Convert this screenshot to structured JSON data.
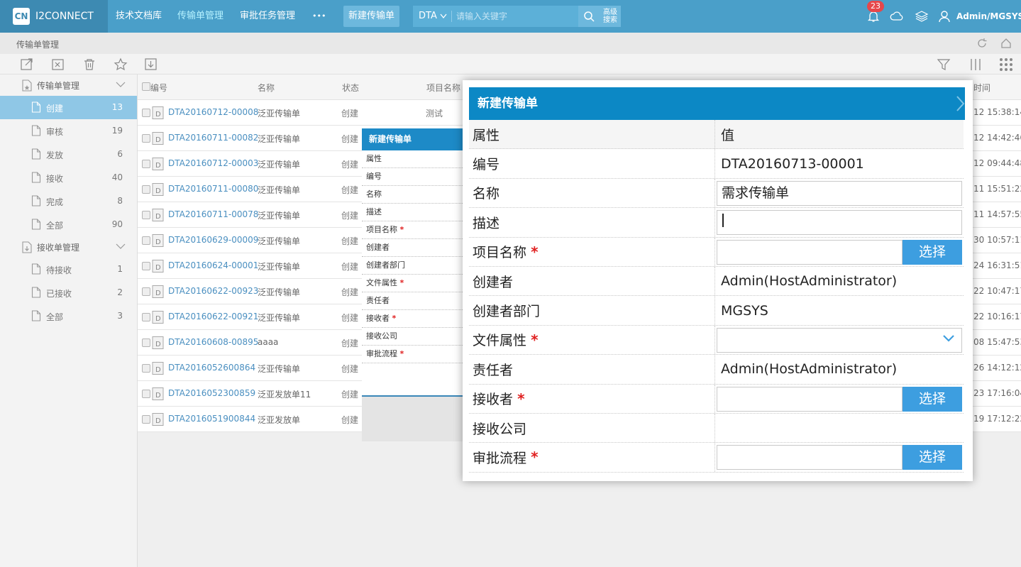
{
  "topbar": {
    "brand": "I2CONNECT",
    "brand_logo": "CN",
    "nav": [
      "技术文档库",
      "传输单管理",
      "审批任务管理"
    ],
    "more": "•••",
    "new_button": "新建传输单",
    "search_scope": "DTA",
    "search_placeholder": "请输入关键字",
    "advanced": [
      "高级",
      "搜索"
    ],
    "notification_count": "23",
    "user": "Admin/MGSYS",
    "colors": {
      "bar": "#4a9fc9",
      "brand_bg": "#3d8ab2",
      "badge": "#e6474b"
    }
  },
  "breadcrumb": "传输单管理",
  "sidebar": {
    "groups": [
      {
        "label": "传输单管理",
        "items": [
          {
            "label": "创建",
            "count": "13"
          },
          {
            "label": "审核",
            "count": "19"
          },
          {
            "label": "发放",
            "count": "6"
          },
          {
            "label": "接收",
            "count": "40"
          },
          {
            "label": "完成",
            "count": "8"
          },
          {
            "label": "全部",
            "count": "90"
          }
        ]
      },
      {
        "label": "接收单管理",
        "items": [
          {
            "label": "待接收",
            "count": "1"
          },
          {
            "label": "已接收",
            "count": "2"
          },
          {
            "label": "全部",
            "count": "3"
          }
        ]
      }
    ]
  },
  "table": {
    "headers": {
      "code": "编号",
      "name": "名称",
      "status": "状态",
      "project": "项目名称",
      "time": "时间"
    },
    "rows": [
      {
        "code": "DTA20160712-00008",
        "name": "泛亚传输单",
        "status": "创建",
        "project": "测试",
        "time": "12 15:38:14"
      },
      {
        "code": "DTA20160711-00082",
        "name": "泛亚传输单",
        "status": "创建",
        "project": "",
        "time": "12 14:42:46"
      },
      {
        "code": "DTA20160712-00003",
        "name": "泛亚传输单",
        "status": "创建",
        "project": "",
        "time": "12 09:44:48"
      },
      {
        "code": "DTA20160711-00080",
        "name": "泛亚传输单",
        "status": "创建",
        "project": "",
        "time": "11 15:51:22"
      },
      {
        "code": "DTA20160711-00078",
        "name": "泛亚传输单",
        "status": "创建",
        "project": "",
        "time": "11 14:57:55"
      },
      {
        "code": "DTA20160629-00009",
        "name": "泛亚传输单",
        "status": "创建",
        "project": "",
        "time": "30 10:57:11"
      },
      {
        "code": "DTA20160624-00001",
        "name": "泛亚传输单",
        "status": "创建",
        "project": "",
        "time": "24 16:31:51"
      },
      {
        "code": "DTA20160622-00923",
        "name": "泛亚传输单",
        "status": "创建",
        "project": "",
        "time": "22 10:47:17"
      },
      {
        "code": "DTA20160622-00921",
        "name": "泛亚传输单",
        "status": "创建",
        "project": "",
        "time": "22 10:16:17"
      },
      {
        "code": "DTA20160608-00895",
        "name": "aaaa",
        "status": "创建",
        "project": "",
        "time": "08 15:47:53"
      },
      {
        "code": "DTA2016052600864",
        "name": "泛亚传输单",
        "status": "创建",
        "project": "",
        "time": "26 14:12:12"
      },
      {
        "code": "DTA2016052300859",
        "name": "泛亚发放单11",
        "status": "创建",
        "project": "",
        "time": "23 17:16:04"
      },
      {
        "code": "DTA2016051900844",
        "name": "泛亚发放单",
        "status": "创建",
        "project": "",
        "time": "19 17:12:22"
      }
    ]
  },
  "small_dialog": {
    "title": "新建传输单",
    "rows": [
      {
        "label": "属性",
        "required": false
      },
      {
        "label": "编号",
        "required": false
      },
      {
        "label": "名称",
        "required": false
      },
      {
        "label": "描述",
        "required": false
      },
      {
        "label": "项目名称",
        "required": true
      },
      {
        "label": "创建者",
        "required": false
      },
      {
        "label": "创建者部门",
        "required": false
      },
      {
        "label": "文件属性",
        "required": true
      },
      {
        "label": "责任者",
        "required": false
      },
      {
        "label": "接收者",
        "required": true
      },
      {
        "label": "接收公司",
        "required": false
      },
      {
        "label": "审批流程",
        "required": true
      }
    ]
  },
  "dialog": {
    "title": "新建传输单",
    "header_key": "属性",
    "header_value": "值",
    "required_mark": "*",
    "select_label": "选择",
    "fields": [
      {
        "label": "编号",
        "type": "text",
        "value": "DTA20160713-00001"
      },
      {
        "label": "名称",
        "type": "input",
        "value": "需求传输单"
      },
      {
        "label": "描述",
        "type": "input",
        "value": ""
      },
      {
        "label": "项目名称",
        "type": "select-btn",
        "value": "",
        "required": true
      },
      {
        "label": "创建者",
        "type": "text",
        "value": "Admin(HostAdministrator)"
      },
      {
        "label": "创建者部门",
        "type": "text",
        "value": "MGSYS"
      },
      {
        "label": "文件属性",
        "type": "dropdown",
        "value": "",
        "required": true
      },
      {
        "label": "责任者",
        "type": "text",
        "value": "Admin(HostAdministrator)"
      },
      {
        "label": "接收者",
        "type": "select-btn",
        "value": "",
        "required": true
      },
      {
        "label": "接收公司",
        "type": "text",
        "value": ""
      },
      {
        "label": "审批流程",
        "type": "select-btn",
        "value": "",
        "required": true
      }
    ]
  }
}
